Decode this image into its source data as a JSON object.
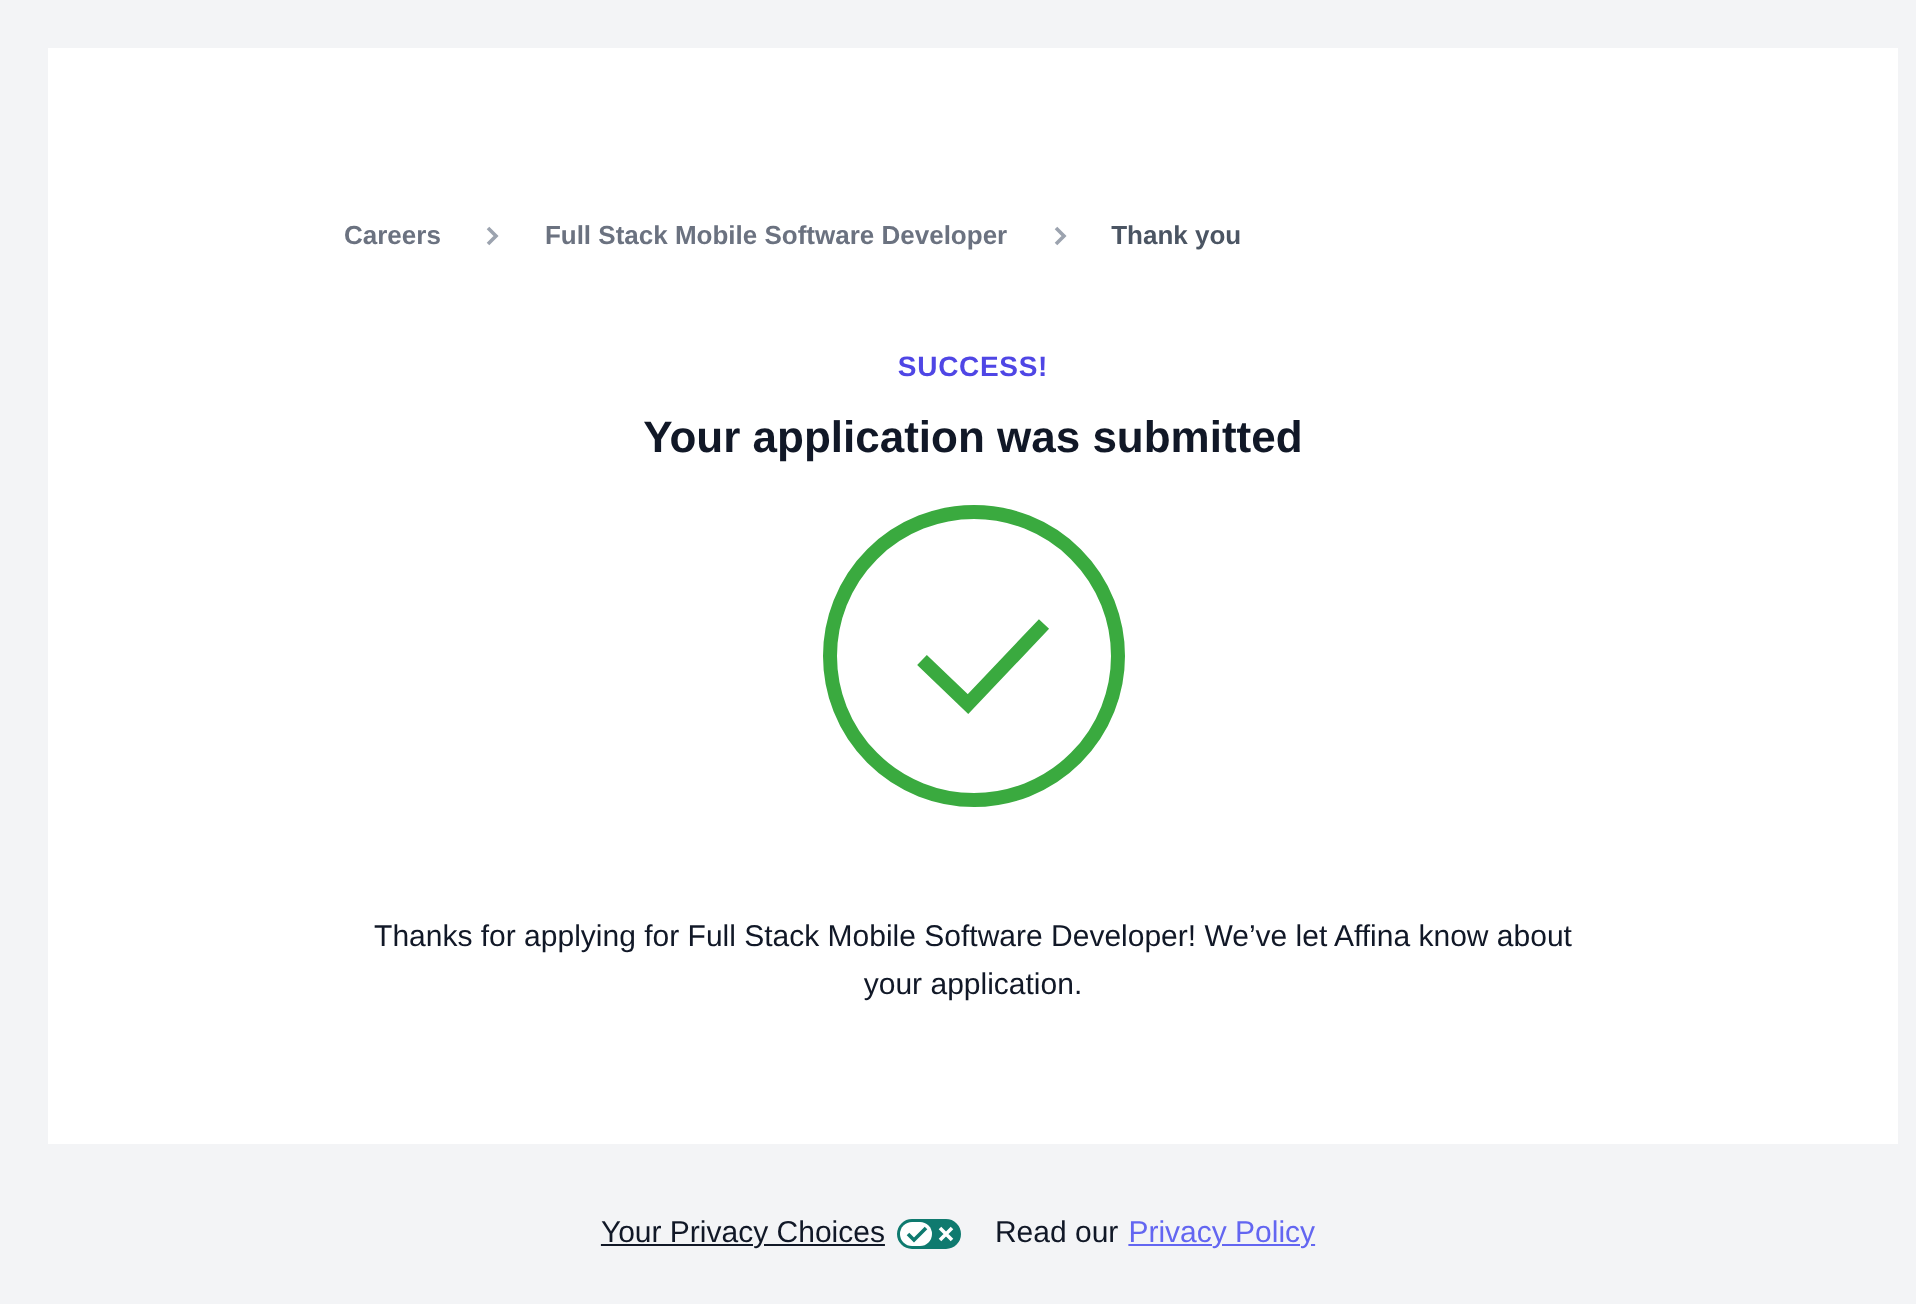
{
  "breadcrumb": [
    {
      "label": "Careers",
      "current": false
    },
    {
      "label": "Full Stack Mobile Software Developer",
      "current": false
    },
    {
      "label": "Thank you",
      "current": true
    }
  ],
  "eyebrow": "SUCCESS!",
  "heading": "Your application was submitted",
  "message": "Thanks for applying for Full Stack Mobile Software Developer! We’ve let Affina know about your application.",
  "footer": {
    "privacy_choices": "Your Privacy Choices",
    "read_our": "Read our",
    "privacy_policy": "Privacy Policy"
  }
}
